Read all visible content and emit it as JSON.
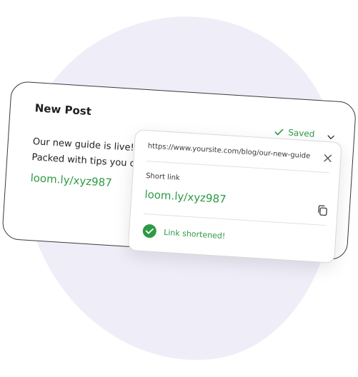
{
  "post": {
    "title": "New Post",
    "status_label": "Saved",
    "text_line1_start": "Our new guide is live! ",
    "text_line1_selected": "  ",
    "text_line2": "Packed with tips you ca",
    "link": "loom.ly/xyz987"
  },
  "popover": {
    "url": "https://www.yoursite.com/blog/our-new-guide",
    "short_label": "Short link",
    "short_link": "loom.ly/xyz987",
    "confirmation": "Link shortened!"
  },
  "icons": {
    "saved": "check-icon",
    "menu": "chevron-down-icon",
    "close": "close-icon",
    "copy": "copy-icon",
    "success": "check-circle-icon"
  },
  "colors": {
    "accent": "#2e9a45",
    "background_blob": "#efedf8"
  }
}
